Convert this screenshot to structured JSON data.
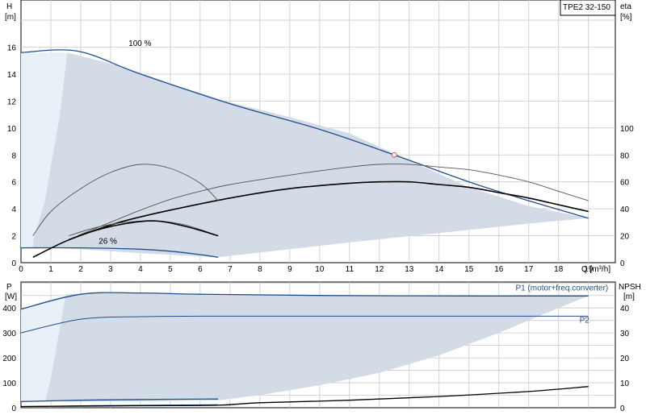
{
  "colors": {
    "region": "#d3dce6",
    "region_light": "#e9f0f8",
    "curve_blue": "#1f4e8c",
    "curve_black": "#000000",
    "curve_gray": "#555555",
    "duty_point": "#d9534f",
    "label_blue": "#1f4e8c"
  },
  "chart_data": [
    {
      "id": "head",
      "type": "line",
      "title": "TPE2 32-150",
      "xlabel": "Q [m³/h]",
      "ylabel_left": [
        "H",
        "[m]"
      ],
      "ylabel_right": [
        "eta",
        "[%]"
      ],
      "xlim": [
        0,
        19.9
      ],
      "ylim": [
        0,
        19.5
      ],
      "ylim_right": [
        0,
        195
      ],
      "xticks": [
        "0",
        "1",
        "2",
        "3",
        "4",
        "5",
        "6",
        "7",
        "8",
        "9",
        "10",
        "11",
        "12",
        "13",
        "14",
        "15",
        "16",
        "17",
        "18",
        "19"
      ],
      "yticks_left": [
        "0",
        "2",
        "4",
        "6",
        "8",
        "10",
        "12",
        "14",
        "16"
      ],
      "yticks_right": [
        "0",
        "20",
        "40",
        "60",
        "80",
        "100"
      ],
      "grid": true,
      "annotations": [
        {
          "text": "100 %",
          "x": 3.6,
          "y": 16.1
        },
        {
          "text": "26 %",
          "x": 2.6,
          "y": 1.4
        }
      ],
      "duty_point": {
        "x": 12.5,
        "y": 8.0
      },
      "operating_region": [
        [
          1.55,
          15.6
        ],
        [
          3.5,
          14.5
        ],
        [
          5,
          13.3
        ],
        [
          7,
          11.9
        ],
        [
          9,
          10.8
        ],
        [
          11,
          9.6
        ],
        [
          13,
          7.6
        ],
        [
          15,
          5.6
        ],
        [
          17,
          4.2
        ],
        [
          19,
          3.3
        ],
        [
          17,
          2.9
        ],
        [
          14,
          2.2
        ],
        [
          11,
          1.5
        ],
        [
          9,
          1.0
        ],
        [
          6.6,
          0.4
        ],
        [
          4,
          0.7
        ],
        [
          2,
          1.0
        ],
        [
          1,
          1.1
        ],
        [
          0.4,
          1.1
        ],
        [
          0.4,
          1.6
        ],
        [
          0.8,
          4.6
        ],
        [
          1.3,
          11
        ],
        [
          1.55,
          15.6
        ]
      ],
      "light_region": [
        [
          0,
          15.6
        ],
        [
          1.55,
          15.6
        ],
        [
          1.3,
          11
        ],
        [
          0.8,
          4.6
        ],
        [
          0.4,
          1.6
        ],
        [
          0.4,
          1.1
        ],
        [
          0,
          1.1
        ]
      ],
      "series": [
        {
          "role": "head_max",
          "color": "#1f4e8c",
          "width": 1.3,
          "points": [
            [
              0,
              15.6
            ],
            [
              1.9,
              15.7
            ],
            [
              4,
              14.0
            ],
            [
              7,
              11.8
            ],
            [
              10,
              9.9
            ],
            [
              12.5,
              8.0
            ],
            [
              15,
              6.0
            ],
            [
              17,
              4.6
            ],
            [
              19,
              3.3
            ]
          ]
        },
        {
          "role": "head_min",
          "color": "#1f4e8c",
          "width": 1.3,
          "points": [
            [
              0,
              1.1
            ],
            [
              2,
              1.1
            ],
            [
              4,
              1.0
            ],
            [
              5,
              0.85
            ],
            [
              6,
              0.6
            ],
            [
              6.6,
              0.4
            ]
          ]
        },
        {
          "role": "eta_max",
          "color": "#555555",
          "width": 0.9,
          "points": [
            [
              1.9,
              2.0
            ],
            [
              3,
              3.0
            ],
            [
              4,
              3.9
            ],
            [
              5,
              4.7
            ],
            [
              6,
              5.3
            ],
            [
              7,
              5.8
            ],
            [
              9,
              6.5
            ],
            [
              11,
              7.1
            ],
            [
              12,
              7.3
            ],
            [
              13,
              7.3
            ],
            [
              14,
              7.1
            ],
            [
              15,
              6.9
            ],
            [
              16,
              6.5
            ],
            [
              17,
              6.0
            ],
            [
              18,
              5.3
            ],
            [
              19,
              4.6
            ]
          ]
        },
        {
          "role": "eta_max_bold",
          "color": "#000000",
          "width": 1.6,
          "points": [
            [
              1.6,
              1.7
            ],
            [
              3,
              2.8
            ],
            [
              4,
              3.4
            ],
            [
              5,
              3.9
            ],
            [
              7,
              4.8
            ],
            [
              9,
              5.5
            ],
            [
              11,
              5.9
            ],
            [
              12,
              6.0
            ],
            [
              13,
              6.0
            ],
            [
              14,
              5.8
            ],
            [
              15,
              5.6
            ],
            [
              16,
              5.2
            ],
            [
              17,
              4.8
            ],
            [
              18,
              4.3
            ],
            [
              19,
              3.8
            ]
          ]
        },
        {
          "role": "eta_arc_thin",
          "color": "#555555",
          "width": 0.9,
          "points": [
            [
              0.4,
              2.0
            ],
            [
              1,
              3.8
            ],
            [
              2,
              5.5
            ],
            [
              3,
              6.7
            ],
            [
              4,
              7.3
            ],
            [
              5,
              7.0
            ],
            [
              6,
              5.9
            ],
            [
              6.6,
              4.6
            ]
          ]
        },
        {
          "role": "eta_arc_small",
          "color": "#555555",
          "width": 0.9,
          "points": [
            [
              1.6,
              2.0
            ],
            [
              2.5,
              2.6
            ],
            [
              3.5,
              3.0
            ],
            [
              4.5,
              3.1
            ],
            [
              5.5,
              2.8
            ],
            [
              6.6,
              2.0
            ]
          ]
        },
        {
          "role": "eta_min_bold",
          "color": "#000000",
          "width": 1.6,
          "points": [
            [
              0.4,
              0.4
            ],
            [
              1.5,
              1.6
            ],
            [
              2.5,
              2.4
            ],
            [
              3.5,
              2.9
            ],
            [
              4.5,
              3.1
            ],
            [
              5.5,
              2.7
            ],
            [
              6.6,
              2.0
            ]
          ]
        }
      ]
    },
    {
      "id": "power",
      "type": "line",
      "xlim": [
        0,
        19.9
      ],
      "ylim": [
        0,
        504
      ],
      "ylim_right": [
        0,
        50.4
      ],
      "ylabel_left": [
        "P",
        "[W]"
      ],
      "ylabel_right": [
        "NPSH",
        "[m]"
      ],
      "yticks_left": [
        "0",
        "100",
        "200",
        "300",
        "400"
      ],
      "yticks_right": [
        "0",
        "10",
        "20",
        "30",
        "40"
      ],
      "grid": true,
      "labels": [
        {
          "text": "P1 (motor+freq.converter)",
          "x": 17.5,
          "y": 480
        },
        {
          "text": "P2",
          "x": 18.7,
          "y": 350
        }
      ],
      "operating_region": [
        [
          1.5,
          455
        ],
        [
          3,
          460
        ],
        [
          6,
          455
        ],
        [
          10,
          450
        ],
        [
          15,
          448
        ],
        [
          19,
          448
        ],
        [
          18,
          400
        ],
        [
          16,
          300
        ],
        [
          14,
          210
        ],
        [
          12,
          140
        ],
        [
          10,
          90
        ],
        [
          8,
          50
        ],
        [
          6.6,
          30
        ],
        [
          4,
          25
        ],
        [
          2,
          25
        ],
        [
          0.8,
          25
        ],
        [
          1.0,
          120
        ],
        [
          1.5,
          455
        ]
      ],
      "light_region": [
        [
          0,
          395
        ],
        [
          1.5,
          455
        ],
        [
          1.0,
          120
        ],
        [
          0.8,
          25
        ],
        [
          0,
          25
        ]
      ],
      "series": [
        {
          "role": "p1_max",
          "color": "#1f4e8c",
          "width": 1.3,
          "points": [
            [
              0,
              395
            ],
            [
              2,
              455
            ],
            [
              4,
              460
            ],
            [
              6,
              455
            ],
            [
              10,
              450
            ],
            [
              15,
              448
            ],
            [
              19,
              448
            ]
          ]
        },
        {
          "role": "p2_max",
          "color": "#1f4e8c",
          "width": 1.0,
          "points": [
            [
              0,
              300
            ],
            [
              2,
              355
            ],
            [
              4,
              365
            ],
            [
              6,
              367
            ],
            [
              10,
              367
            ],
            [
              15,
              367
            ],
            [
              19,
              367
            ]
          ]
        },
        {
          "role": "p1_min",
          "color": "#1f4e8c",
          "width": 1.3,
          "points": [
            [
              0,
              25
            ],
            [
              2,
              30
            ],
            [
              4,
              33
            ],
            [
              6.6,
              35
            ]
          ]
        },
        {
          "role": "p2_min",
          "color": "#1f4e8c",
          "width": 1.0,
          "points": [
            [
              0,
              5
            ],
            [
              2,
              8
            ],
            [
              4,
              10
            ],
            [
              6.6,
              12
            ]
          ]
        },
        {
          "role": "npsh",
          "color": "#000000",
          "width": 1.3,
          "points": [
            [
              0,
              5
            ],
            [
              4,
              8
            ],
            [
              6.6,
              10
            ],
            [
              8,
              20
            ],
            [
              11,
              30
            ],
            [
              14,
              45
            ],
            [
              17,
              65
            ],
            [
              19,
              85
            ]
          ]
        }
      ]
    }
  ]
}
